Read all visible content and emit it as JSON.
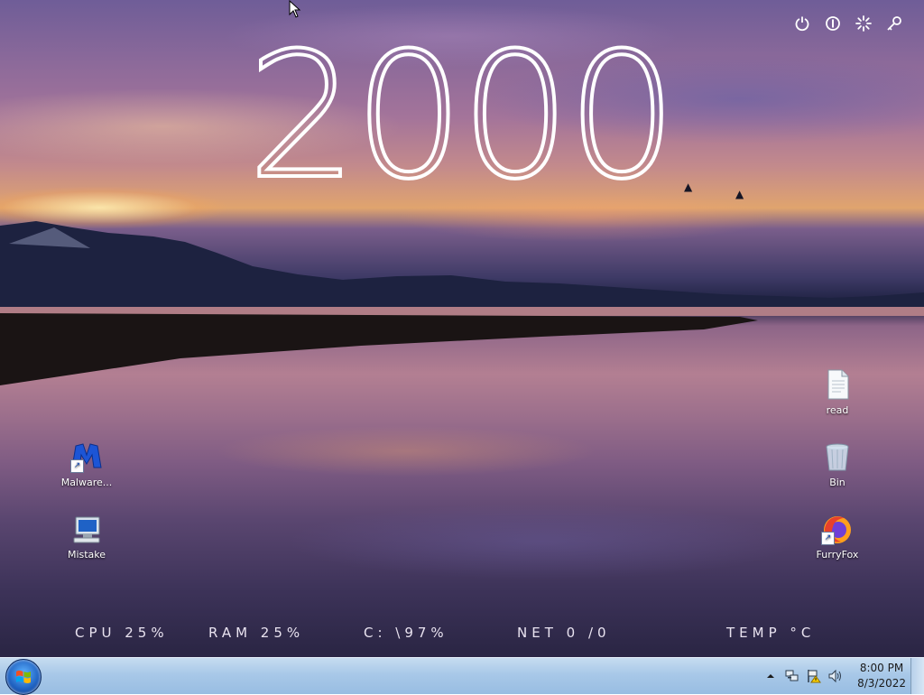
{
  "clock": {
    "value": "2000"
  },
  "top_icons": [
    "power-icon",
    "info-icon",
    "settings-sun-icon",
    "key-icon"
  ],
  "desktop_icons": [
    {
      "label": "Malware...",
      "icon": "malwarebytes-icon",
      "shortcut": true
    },
    {
      "label": "Mistake",
      "icon": "computer-monitor-icon",
      "shortcut": false
    },
    {
      "label": "read",
      "icon": "text-file-icon",
      "shortcut": false
    },
    {
      "label": "Bin",
      "icon": "recycle-bin-icon",
      "shortcut": false
    },
    {
      "label": "FurryFox",
      "icon": "firefox-icon",
      "shortcut": true
    }
  ],
  "stats": {
    "cpu": "CPU 25%",
    "ram": "RAM 25%",
    "disk": "C: \\97%",
    "net": "NET 0 /0",
    "temp": "TEMP °C"
  },
  "taskbar": {
    "time": "8:00 PM",
    "date": "8/3/2022",
    "tray_icons": [
      "show-hidden-icons-arrow",
      "network-icon",
      "action-center-warning-icon",
      "volume-icon"
    ]
  },
  "colors": {
    "taskbar": "#a8c8e8",
    "accent": "#1d5fbf"
  }
}
